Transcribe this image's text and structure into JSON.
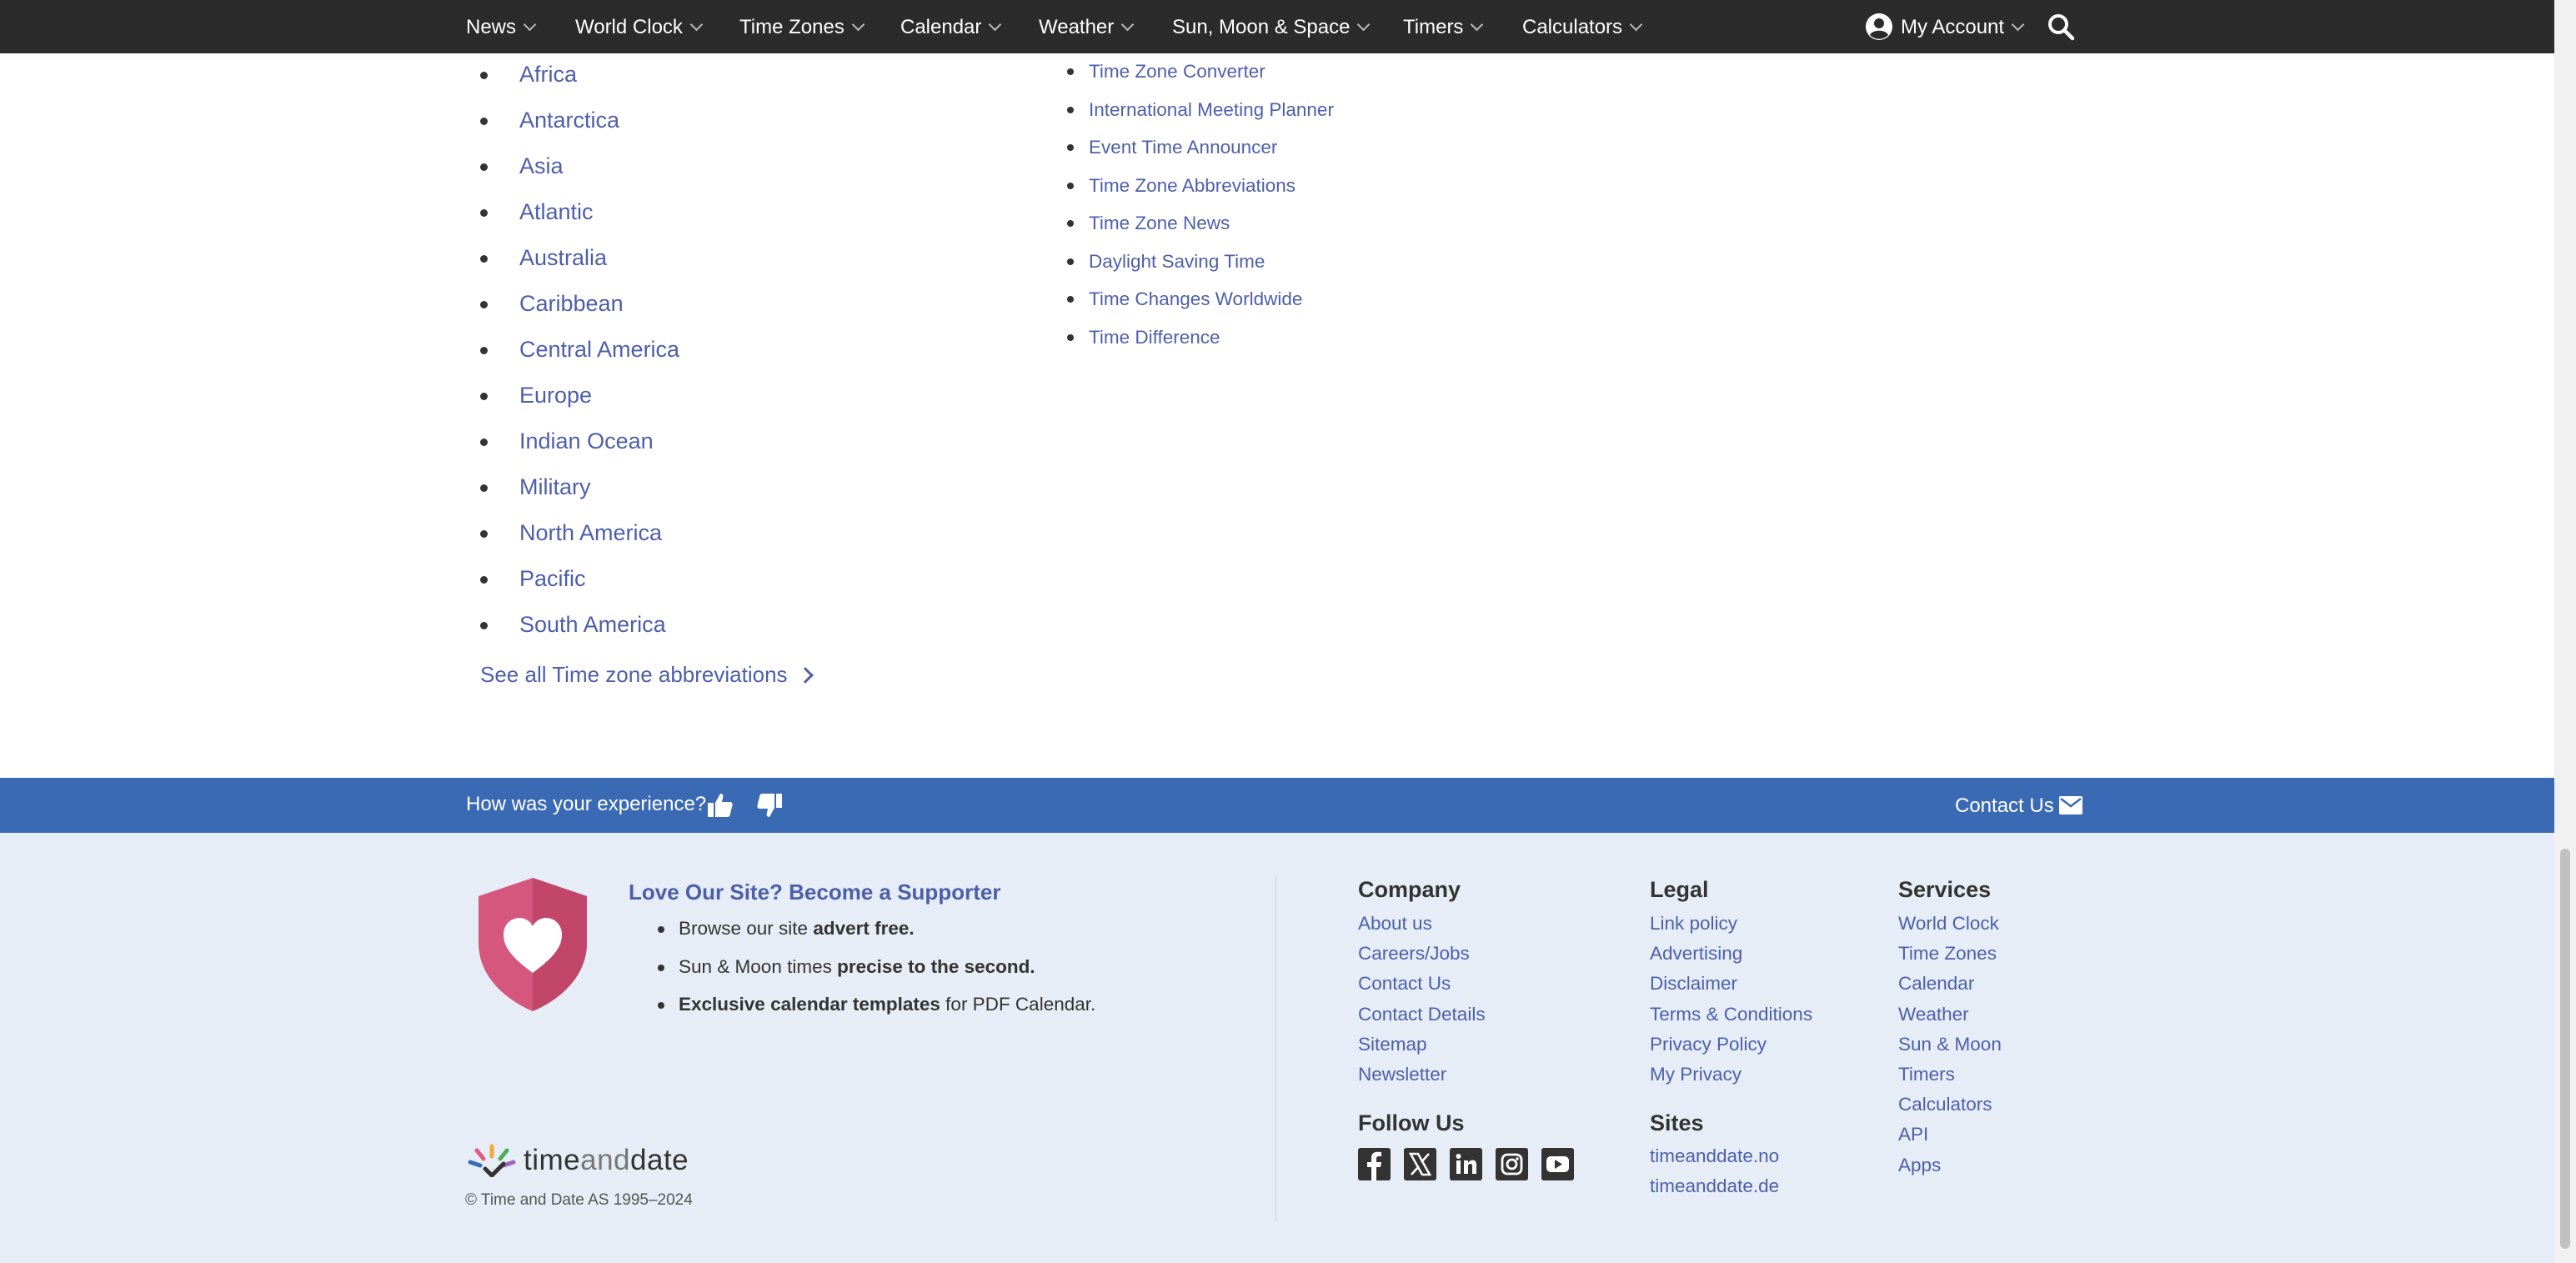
{
  "nav": {
    "items": [
      "News",
      "World Clock",
      "Time Zones",
      "Calendar",
      "Weather",
      "Sun, Moon & Space",
      "Timers",
      "Calculators"
    ],
    "account_label": "My Account"
  },
  "regions": [
    "Africa",
    "Antarctica",
    "Asia",
    "Atlantic",
    "Australia",
    "Caribbean",
    "Central America",
    "Europe",
    "Indian Ocean",
    "Military",
    "North America",
    "Pacific",
    "South America"
  ],
  "see_all_label": "See all Time zone abbreviations",
  "tools": [
    "Time Zone Converter",
    "International Meeting Planner",
    "Event Time Announcer",
    "Time Zone Abbreviations",
    "Time Zone News",
    "Daylight Saving Time",
    "Time Changes Worldwide",
    "Time Difference"
  ],
  "feedback": {
    "question": "How was your experience?",
    "contact_label": "Contact Us"
  },
  "supporter": {
    "title": "Love Our Site? Become a Supporter",
    "b1_pre": "Browse our site ",
    "b1_bold": "advert free.",
    "b2_pre": "Sun & Moon times ",
    "b2_bold": "precise to the second.",
    "b3_bold": "Exclusive calendar templates",
    "b3_post": " for PDF Calendar."
  },
  "logo": {
    "part1": "time",
    "part2": "and",
    "part3": "date"
  },
  "copyright": "© Time and Date AS 1995–2024",
  "company": {
    "title": "Company",
    "links": [
      "About us",
      "Careers/Jobs",
      "Contact Us",
      "Contact Details",
      "Sitemap",
      "Newsletter"
    ]
  },
  "legal": {
    "title": "Legal",
    "links": [
      "Link policy",
      "Advertising",
      "Disclaimer",
      "Terms & Conditions",
      "Privacy Policy",
      "My Privacy"
    ]
  },
  "services": {
    "title": "Services",
    "links": [
      "World Clock",
      "Time Zones",
      "Calendar",
      "Weather",
      "Sun & Moon",
      "Timers",
      "Calculators",
      "API",
      "Apps"
    ]
  },
  "follow": {
    "title": "Follow Us"
  },
  "sites": {
    "title": "Sites",
    "links": [
      "timeanddate.no",
      "timeanddate.de"
    ]
  },
  "colors": {
    "nav_bg": "#2b2b2b",
    "link": "#4e5fa9",
    "feedback_bar": "#3b6ab4",
    "footer_bg": "#e6edf6",
    "shield": "#d6577e"
  }
}
